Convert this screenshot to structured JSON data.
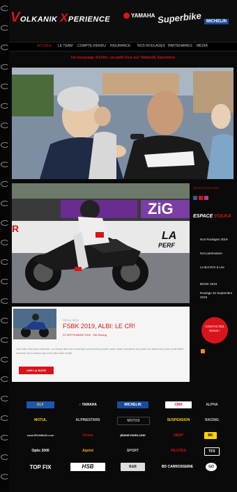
{
  "header": {
    "logo": {
      "v": "V",
      "olkanik": "OLKANIK ",
      "x": "X",
      "perience": "PERIENCE"
    },
    "sponsors": {
      "yamaha": "YAMAHA",
      "superbike": "Superbike",
      "michelin": "MICHELIN"
    }
  },
  "nav": {
    "items": [
      "ACCUEIL",
      "LE TEAM",
      "COMPTE-RENDU",
      "INSURANCE",
      "NOS ROULAGES",
      "PARTENAIRES",
      "MÉDIA"
    ]
  },
  "subnav": {
    "text": "Un essayage d'enfer, un petit tour sur Volkanik Xperience"
  },
  "sidebar": {
    "follow_label": "SUIVEZ-NOUS SUR",
    "space_title_white": "ESPACE ",
    "space_title_red": "VOLKA",
    "items": [
      "Nos Roulages 2019",
      "Nos partenaires",
      "Le Bol d'Or à Lire",
      "BOOK 2019",
      "Roulage 22 Septembre 2019"
    ],
    "contact": "CONTACTEZ NOUS !"
  },
  "article": {
    "category": "RESULTATS",
    "title": "FSBK 2019, ALBI: LE CR!",
    "meta": "22 SEPTEMBRE 2019 · Elk Racing",
    "excerpt": "Une fois n'est pas coutume, on réussi des lots et surtout une bonne journée avec deux mécanos sur place ce week end pour la dernière manche de la saison qui s'est déroulée à Albi.",
    "more": "LIRE LA SUITE"
  },
  "sponsors": {
    "row1": [
      "ELF",
      "YAMAHA",
      "MICHELIN",
      "CMS",
      "ALPHA"
    ],
    "row2": [
      "MOTUL",
      "ALPINESTARS",
      "MOTOS",
      "SUSPENSION",
      "RACING"
    ],
    "row3": [
      "www.IRONMAN.com",
      "Cirrus",
      "planet-moto.com",
      "DEEP",
      "BK"
    ],
    "row4": [
      "Optic 2000",
      "Alprint",
      "SPORT",
      "PILOTES",
      "TFX"
    ],
    "row5": [
      "TOP FIX",
      "HSB",
      "B&B",
      "BD CARROSSERIE",
      "GO"
    ]
  },
  "colors": {
    "accent": "#d8141a",
    "background": "#0a0a0a"
  }
}
